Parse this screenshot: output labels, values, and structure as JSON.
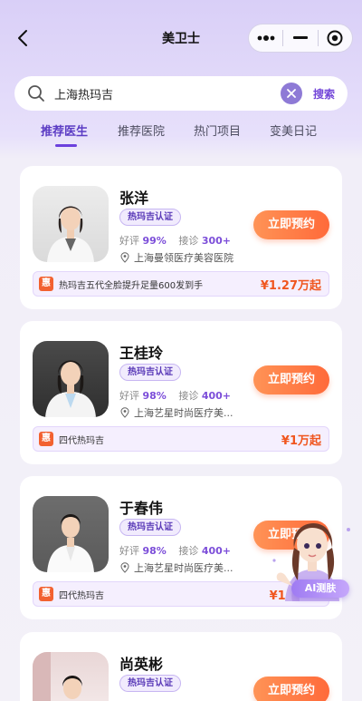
{
  "header": {
    "title": "美卫士"
  },
  "search": {
    "query": "上海热玛吉",
    "button_label": "搜索"
  },
  "tabs": [
    {
      "label": "推荐医生",
      "active": true
    },
    {
      "label": "推荐医院",
      "active": false
    },
    {
      "label": "热门项目",
      "active": false
    },
    {
      "label": "变美日记",
      "active": false
    }
  ],
  "doctors": [
    {
      "name": "张洋",
      "badge": "热玛吉认证",
      "rating_label": "好评",
      "rating": "99%",
      "consult_label": "接诊",
      "consults": "300+",
      "hospital": "上海曼领医疗美容医院",
      "book_label": "立即预约",
      "promo_icon": "惠",
      "promo_text": "热玛吉五代全脸提升足量600发到手",
      "promo_price": "¥1.27万起"
    },
    {
      "name": "王桂玲",
      "badge": "热玛吉认证",
      "rating_label": "好评",
      "rating": "98%",
      "consult_label": "接诊",
      "consults": "400+",
      "hospital": "上海艺星时尚医疗美...",
      "book_label": "立即预约",
      "promo_icon": "惠",
      "promo_text": "四代热玛吉",
      "promo_price": "¥1万起"
    },
    {
      "name": "于春伟",
      "badge": "热玛吉认证",
      "rating_label": "好评",
      "rating": "98%",
      "consult_label": "接诊",
      "consults": "400+",
      "hospital": "上海艺星时尚医疗美...",
      "book_label": "立即预约",
      "promo_icon": "惠",
      "promo_text": "四代热玛吉",
      "promo_price": "¥1.x万起"
    },
    {
      "name": "尚英彬",
      "badge": "热玛吉认证",
      "book_label": "立即预约"
    }
  ],
  "ai_button": {
    "label": "AI测肤"
  },
  "colors": {
    "accent": "#6b40dd",
    "book_button": "#ff7a45",
    "price": "#f0561f"
  }
}
